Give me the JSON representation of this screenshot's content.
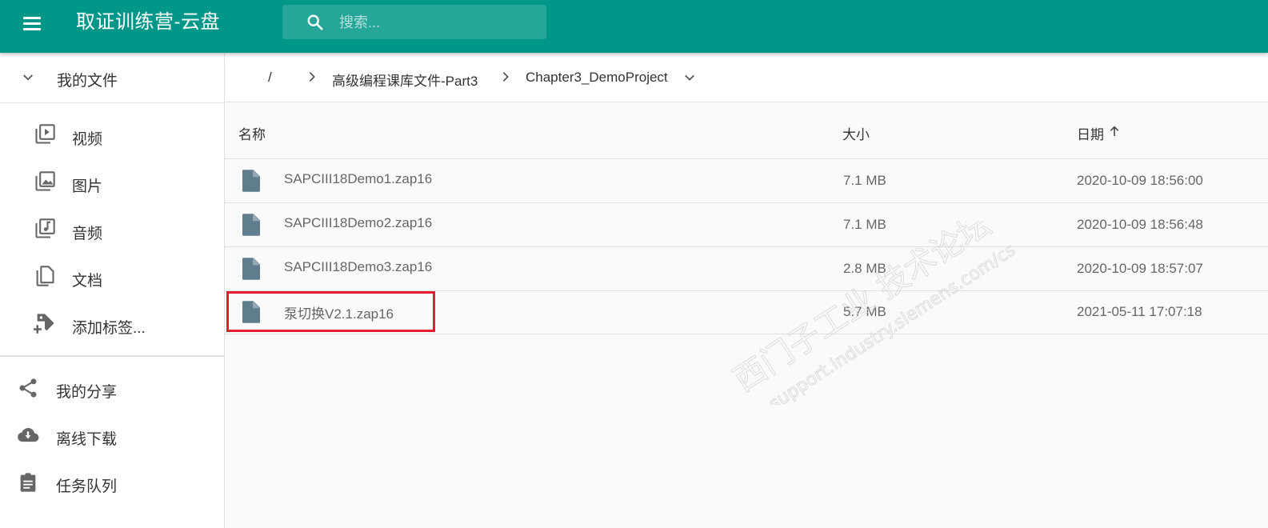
{
  "app": {
    "title": "取证训练营-云盘"
  },
  "search": {
    "placeholder": "搜索..."
  },
  "sidebar": {
    "my_files": "我的文件",
    "items": [
      {
        "label": "视频",
        "icon": "video-library-icon"
      },
      {
        "label": "图片",
        "icon": "photo-library-icon"
      },
      {
        "label": "音频",
        "icon": "library-music-icon"
      },
      {
        "label": "文档",
        "icon": "documents-icon"
      },
      {
        "label": "添加标签...",
        "icon": "add-tag-icon"
      }
    ],
    "bottom": [
      {
        "label": "我的分享",
        "icon": "share-icon"
      },
      {
        "label": "离线下载",
        "icon": "cloud-download-icon"
      },
      {
        "label": "任务队列",
        "icon": "assignment-icon"
      }
    ]
  },
  "breadcrumb": {
    "root": "/",
    "items": [
      "高级编程课库文件-Part3",
      "Chapter3_DemoProject"
    ]
  },
  "table": {
    "headers": {
      "name": "名称",
      "size": "大小",
      "date": "日期"
    },
    "rows": [
      {
        "name": "SAPCIII18Demo1.zap16",
        "size": "7.1 MB",
        "date": "2020-10-09 18:56:00"
      },
      {
        "name": "SAPCIII18Demo2.zap16",
        "size": "7.1 MB",
        "date": "2020-10-09 18:56:48"
      },
      {
        "name": "SAPCIII18Demo3.zap16",
        "size": "2.8 MB",
        "date": "2020-10-09 18:57:07"
      },
      {
        "name": "泵切换V2.1.zap16",
        "size": "5.7 MB",
        "date": "2021-05-11 17:07:18"
      }
    ]
  },
  "watermark": {
    "line1": "西门子工业 技术论坛",
    "line2": "support.industry.siemens.com/cs"
  },
  "colors": {
    "primary": "#009688",
    "highlight": "#e0202e",
    "file_icon": "#5f7d8c"
  }
}
